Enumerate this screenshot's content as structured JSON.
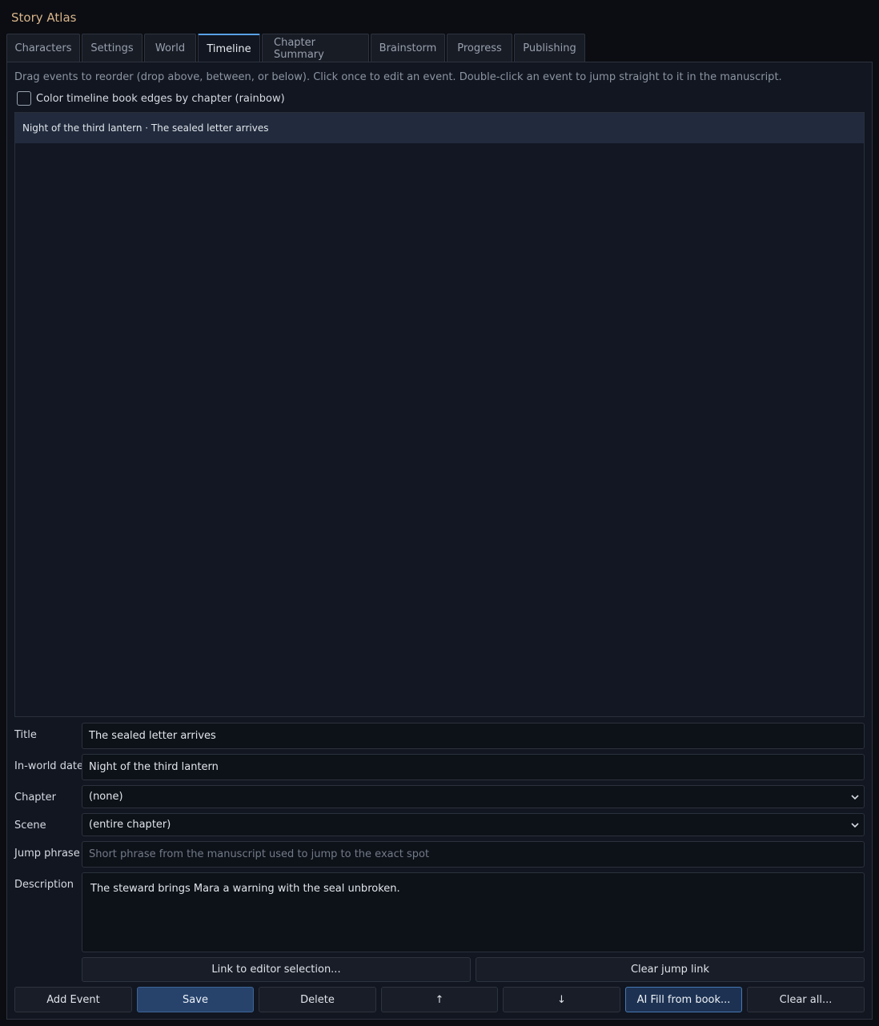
{
  "app": {
    "title": "Story Atlas"
  },
  "tabs": [
    {
      "label": "Characters"
    },
    {
      "label": "Settings"
    },
    {
      "label": "World"
    },
    {
      "label": "Timeline",
      "active": true
    },
    {
      "label": "Chapter Summary"
    },
    {
      "label": "Brainstorm"
    },
    {
      "label": "Progress"
    },
    {
      "label": "Publishing"
    }
  ],
  "timeline": {
    "hint": "Drag events to reorder (drop above, between, or below). Click once to edit an event. Double-click an event to jump straight to it in the manuscript.",
    "color_checkbox_label": "Color timeline  book edges by chapter (rainbow)",
    "color_checkbox_checked": false,
    "events": [
      {
        "label": "Night of the third lantern · The sealed letter arrives",
        "selected": true
      }
    ]
  },
  "form": {
    "title_label": "Title",
    "title_value": "The sealed letter arrives",
    "date_label": "In-world date",
    "date_value": "Night of the third lantern",
    "chapter_label": "Chapter",
    "chapter_value": "(none)",
    "scene_label": "Scene",
    "scene_value": "(entire chapter)",
    "jump_label": "Jump phrase",
    "jump_placeholder": "Short phrase from the manuscript used to jump to the exact spot",
    "description_label": "Description",
    "description_value": "The steward brings Mara a warning with the seal unbroken."
  },
  "link_buttons": {
    "link_label": "Link to editor selection...",
    "clear_label": "Clear jump link"
  },
  "actions": {
    "add": "Add Event",
    "save": "Save",
    "delete": "Delete",
    "up": "↑",
    "down": "↓",
    "ai_fill": "AI Fill from book...",
    "clear_all": "Clear all..."
  },
  "colors": {
    "accent": "#5aa0e6",
    "title": "#d9b48a",
    "background": "#0b0d12",
    "selected_row": "#212b3d"
  }
}
